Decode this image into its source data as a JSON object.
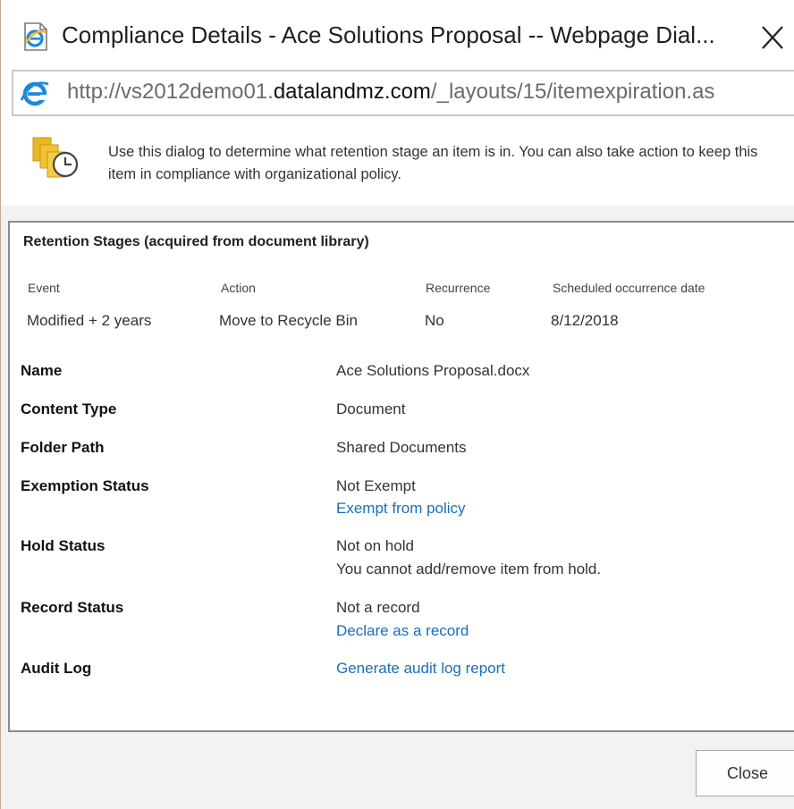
{
  "window": {
    "title": "Compliance Details - Ace Solutions Proposal -- Webpage Dial...",
    "icons": {
      "title": "ie-page-icon",
      "close": "close-icon",
      "address": "ie-logo-icon",
      "intro": "compliance-clock-icon"
    }
  },
  "address": {
    "prefix": "http://vs2012demo01.",
    "domain": "datalandmz.com",
    "suffix": "/_layouts/15/itemexpiration.as"
  },
  "intro": {
    "text": "Use this dialog to determine what retention stage an item is in. You can also take action to keep this item in compliance with organizational policy."
  },
  "retention": {
    "heading": "Retention Stages (acquired from document library)",
    "columns": [
      "Event",
      "Action",
      "Recurrence",
      "Scheduled occurrence date"
    ],
    "row": [
      "Modified + 2 years",
      "Move to Recycle Bin",
      "No",
      "8/12/2018"
    ]
  },
  "properties": {
    "name": {
      "label": "Name",
      "value": "Ace Solutions Proposal.docx"
    },
    "content_type": {
      "label": "Content Type",
      "value": "Document"
    },
    "folder_path": {
      "label": "Folder Path",
      "value": "Shared Documents"
    },
    "exemption": {
      "label": "Exemption Status",
      "value": "Not Exempt",
      "link": "Exempt from policy"
    },
    "hold": {
      "label": "Hold Status",
      "value": "Not on hold",
      "note": "You cannot add/remove item from hold."
    },
    "record": {
      "label": "Record Status",
      "value": "Not a record",
      "link": "Declare as a record"
    },
    "audit": {
      "label": "Audit Log",
      "link": "Generate audit log report"
    }
  },
  "footer": {
    "close_label": "Close"
  },
  "colors": {
    "link": "#1a6fb8",
    "ie_blue": "#1e88d8",
    "folder_yellow": "#e8b820"
  }
}
